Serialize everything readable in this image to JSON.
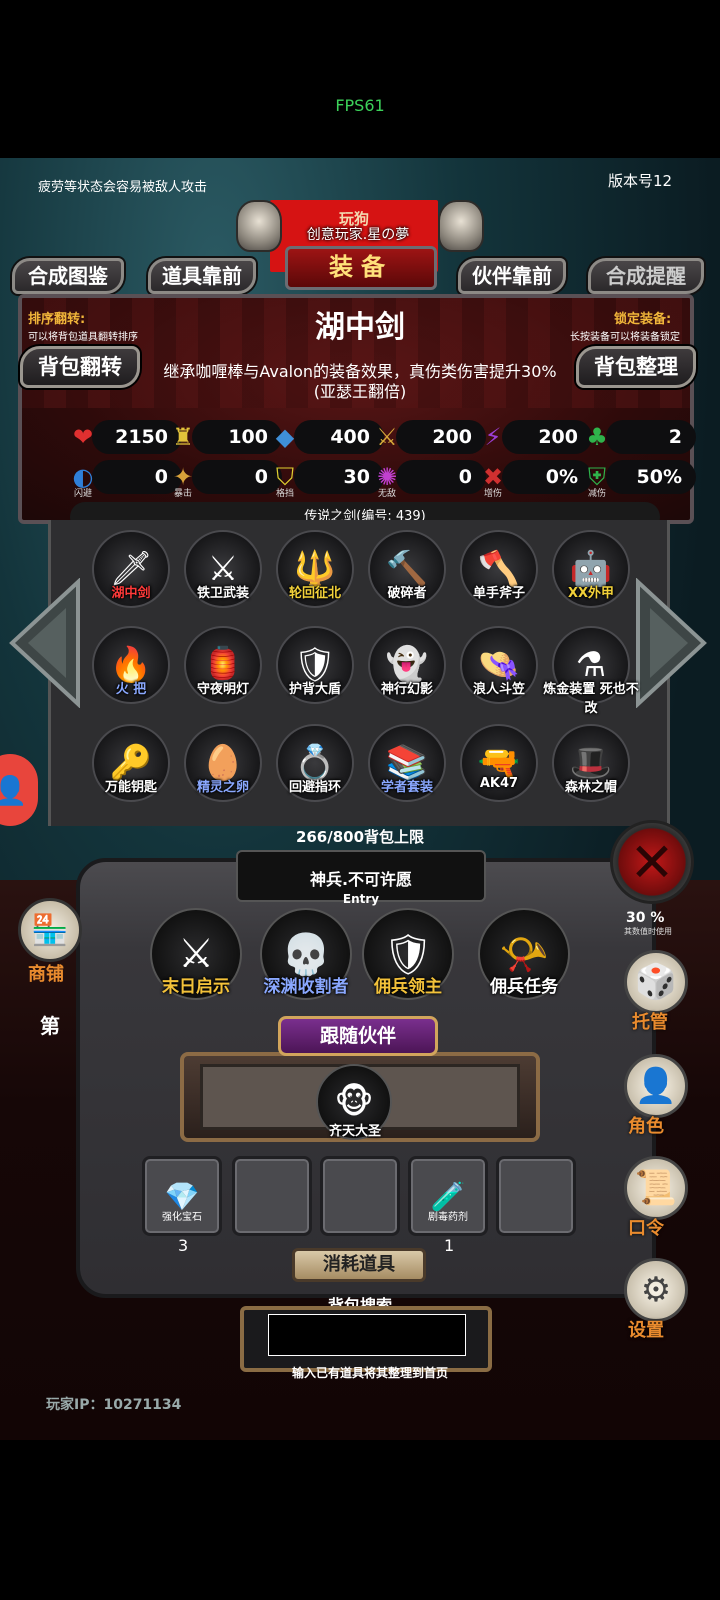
{
  "overlay": {
    "fps": "FPS61"
  },
  "header": {
    "notice": "疲劳等状态会容易被敌人攻击",
    "version": "版本号12",
    "banner_title": "玩狗",
    "creator": "创意玩家.星の夢",
    "equip_tab": "装备"
  },
  "tabs": [
    {
      "label": "合成图鉴"
    },
    {
      "label": "道具靠前"
    },
    {
      "label": "伙伴靠前"
    },
    {
      "label": "合成提醒"
    }
  ],
  "detail": {
    "sort_title": "排序翻转:",
    "sort_hint": "可以将背包道具翻转排序",
    "lock_title": "锁定装备:",
    "lock_hint": "长按装备可以将装备锁定",
    "flip_button": "背包翻转",
    "organize_button": "背包整理",
    "item_name": "湖中剑",
    "description": "继承咖喱棒与Avalon的装备效果，真伤类伤害提升30%(亚瑟王翻倍)"
  },
  "stats": [
    {
      "icon": "heart-icon",
      "value": "2150",
      "label": "",
      "color": "#e03030"
    },
    {
      "icon": "armor-icon",
      "value": "100",
      "label": "",
      "color": "#e3c23a"
    },
    {
      "icon": "boot-icon",
      "value": "400",
      "label": "",
      "color": "#3f8fd8"
    },
    {
      "icon": "sword-icon",
      "value": "200",
      "label": "",
      "color": "#d7a83a"
    },
    {
      "icon": "lightning-icon",
      "value": "200",
      "label": "",
      "color": "#9c3fd6"
    },
    {
      "icon": "clover-icon",
      "value": "2",
      "label": "",
      "color": "#2fb34b"
    },
    {
      "icon": "dodge-icon",
      "value": "0",
      "label": "闪避",
      "color": "#2f7fd8"
    },
    {
      "icon": "crit-icon",
      "value": "0",
      "label": "暴击",
      "color": "#d9a23a"
    },
    {
      "icon": "block-icon",
      "value": "30",
      "label": "格挡",
      "color": "#e0d030"
    },
    {
      "icon": "invincible-icon",
      "value": "0",
      "label": "无敌",
      "color": "#c040d0"
    },
    {
      "icon": "bleed-icon",
      "value": "0%",
      "label": "增伤",
      "color": "#d03030"
    },
    {
      "icon": "reduce-icon",
      "value": "50%",
      "label": "减伤",
      "color": "#2fb34b"
    }
  ],
  "series_label": "传说之剑(编号: 439)",
  "inventory": [
    {
      "name": "湖中剑",
      "color": "#ff3a3a",
      "icon": "🗡"
    },
    {
      "name": "铁卫武装",
      "color": "#ffffff",
      "icon": "⚔"
    },
    {
      "name": "轮回征北",
      "color": "#f3d23a",
      "icon": "🔱"
    },
    {
      "name": "破碎者",
      "color": "#ffffff",
      "icon": "🔨"
    },
    {
      "name": "单手斧子",
      "color": "#ffffff",
      "icon": "🪓"
    },
    {
      "name": "XX外甲",
      "color": "#f3d23a",
      "icon": "🤖"
    },
    {
      "name": "火 把",
      "color": "#8aa8ff",
      "icon": "🔥"
    },
    {
      "name": "守夜明灯",
      "color": "#ffffff",
      "icon": "🏮"
    },
    {
      "name": "护背大盾",
      "color": "#ffffff",
      "icon": "🛡"
    },
    {
      "name": "神行幻影",
      "color": "#ffffff",
      "icon": "👻"
    },
    {
      "name": "浪人斗笠",
      "color": "#ffffff",
      "icon": "👒"
    },
    {
      "name": "炼金装置 死也不改",
      "color": "#ffffff",
      "icon": "⚗"
    },
    {
      "name": "万能钥匙",
      "color": "#ffffff",
      "icon": "🔑"
    },
    {
      "name": "精灵之卵",
      "color": "#8aa8ff",
      "icon": "🥚"
    },
    {
      "name": "回避指环",
      "color": "#ffffff",
      "icon": "💍"
    },
    {
      "name": "学者套装",
      "color": "#8aa8ff",
      "icon": "📚"
    },
    {
      "name": "AK47",
      "color": "#ffffff",
      "icon": "🔫"
    },
    {
      "name": "森林之帽",
      "color": "#ffffff",
      "icon": "🎩"
    }
  ],
  "capacity": "266/800背包上限",
  "entry": {
    "title": "神兵.不可许愿",
    "sub": "Entry"
  },
  "missions": [
    {
      "name": "末日启示",
      "color": "#f3c23a",
      "icon": "⚔"
    },
    {
      "name": "深渊收割者",
      "color": "#8aa8ff",
      "icon": "💀"
    },
    {
      "name": "佣兵领主",
      "color": "#f3c23a",
      "icon": "🛡"
    },
    {
      "name": "佣兵任务",
      "color": "#ffffff",
      "icon": "📯"
    }
  ],
  "companion": {
    "title": "跟随伙伴",
    "name": "齐天大圣"
  },
  "consumables": [
    {
      "name": "强化宝石",
      "count": "3",
      "icon": "💎"
    },
    {
      "name": "",
      "count": "",
      "icon": ""
    },
    {
      "name": "",
      "count": "",
      "icon": ""
    },
    {
      "name": "剧毒药剂",
      "count": "1",
      "icon": "🧪"
    },
    {
      "name": "",
      "count": "",
      "icon": ""
    }
  ],
  "consumables_title": "消耗道具",
  "search": {
    "label": "背包搜索",
    "value": "",
    "hint": "输入已有道具将其整理到首页"
  },
  "player_ip": "玩家IP：10271134",
  "right_menu": {
    "pct": "30 %",
    "pct_sub": "其数值时使用",
    "manage": "托管",
    "role": "角色",
    "command": "口令",
    "settings": "设置"
  },
  "left_menu": {
    "shop": "商铺",
    "di": "第"
  }
}
